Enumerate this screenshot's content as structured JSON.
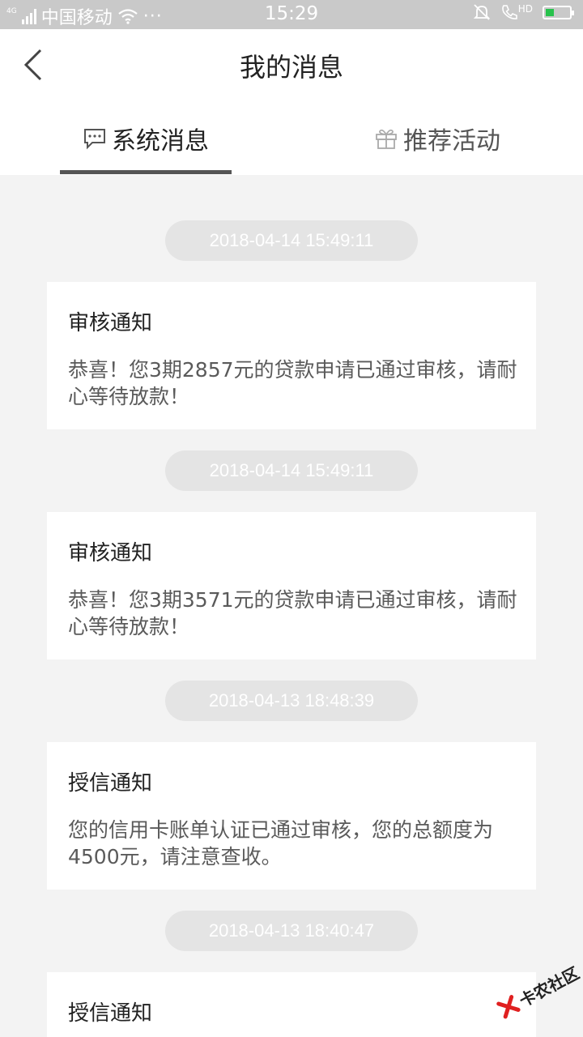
{
  "status_bar": {
    "network_badge": "4G",
    "carrier": "中国移动",
    "more": "···",
    "time": "15:29",
    "hd_label": "HD",
    "battery_level": 0.35
  },
  "header": {
    "title": "我的消息"
  },
  "tabs": [
    {
      "label": "系统消息",
      "icon": "message-bubble-icon",
      "active": true
    },
    {
      "label": "推荐活动",
      "icon": "gift-icon",
      "active": false
    }
  ],
  "messages": [
    {
      "timestamp": "2018-04-14 15:49:11",
      "title": "审核通知",
      "body": "恭喜！您3期2857元的贷款申请已通过审核，请耐心等待放款！"
    },
    {
      "timestamp": "2018-04-14 15:49:11",
      "title": "审核通知",
      "body": "恭喜！您3期3571元的贷款申请已通过审核，请耐心等待放款！"
    },
    {
      "timestamp": "2018-04-13 18:48:39",
      "title": "授信通知",
      "body": "您的信用卡账单认证已通过审核，您的总额度为4500元，请注意查收。"
    },
    {
      "timestamp": "2018-04-13 18:40:47",
      "title": "授信通知",
      "body": ""
    }
  ],
  "watermark": {
    "text": "卡农社区"
  },
  "colors": {
    "accent_green": "#27c24c",
    "watermark_red": "#e02020",
    "page_bg": "#f3f3f3"
  }
}
